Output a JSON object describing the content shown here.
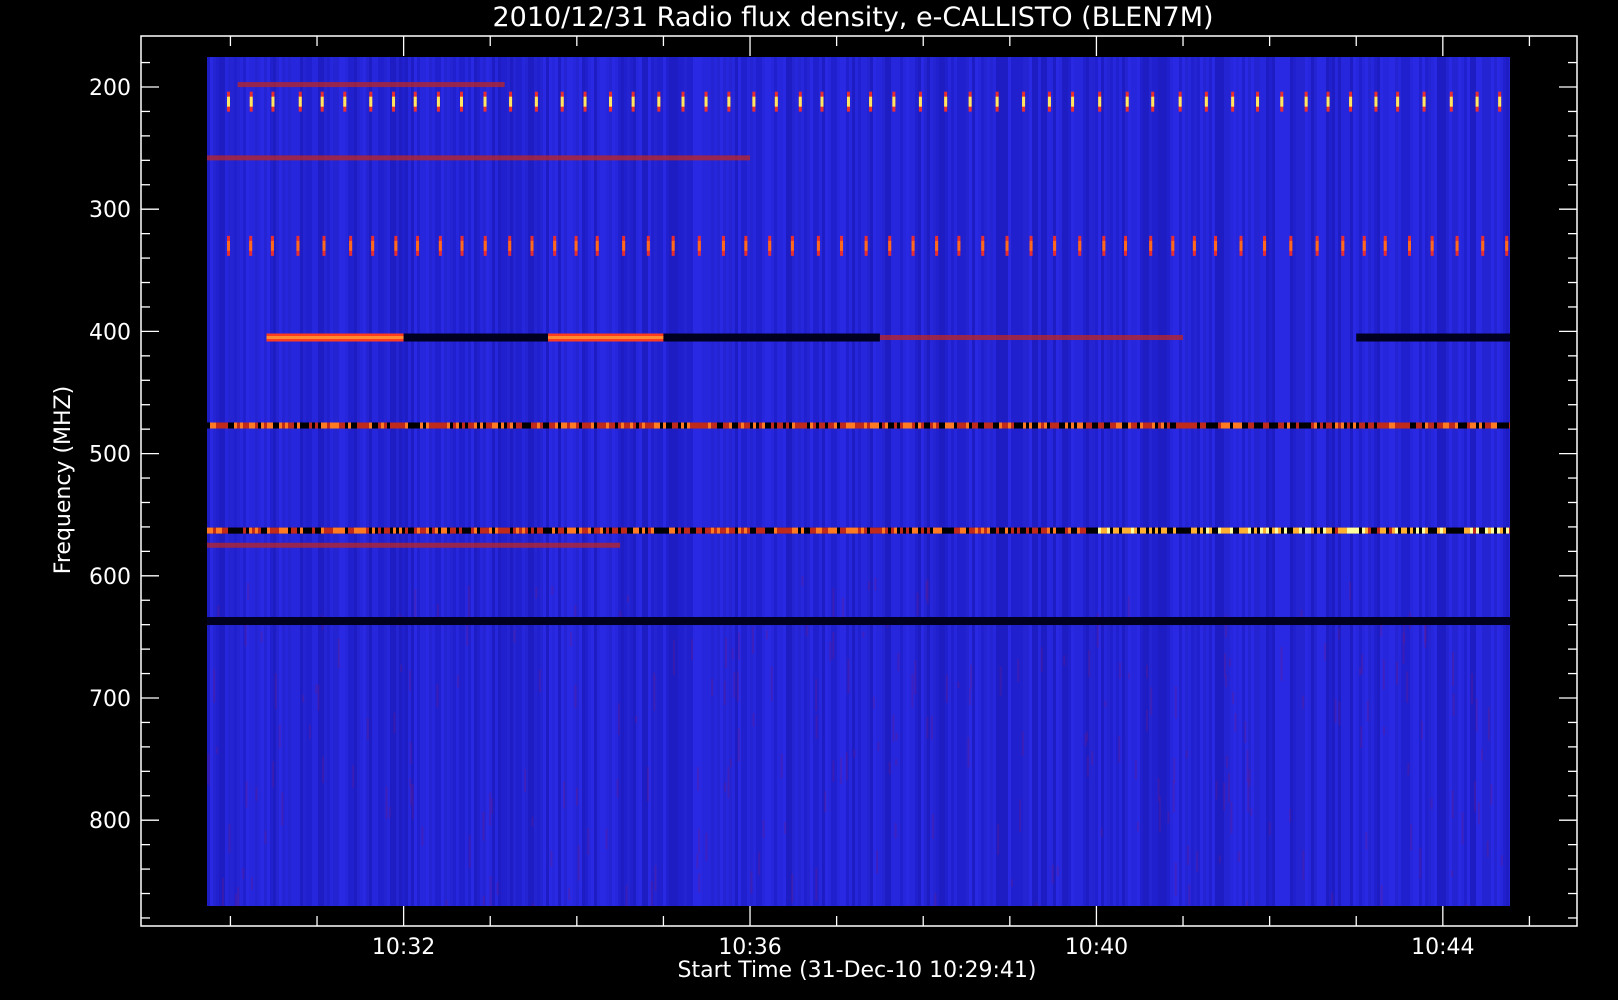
{
  "chart_data": {
    "type": "heatmap",
    "title": "2010/12/31  Radio flux density, e-CALLISTO (BLEN7M)",
    "xlabel": "Start Time (31-Dec-10 10:29:41)",
    "ylabel": "Frequency (MHZ)",
    "x_ticks": [
      "10:32",
      "10:36",
      "10:40",
      "10:44"
    ],
    "y_ticks": [
      "200",
      "300",
      "400",
      "500",
      "600",
      "700",
      "800"
    ],
    "x_range_minutes": [
      10.5,
      10.75
    ],
    "y_range_mhz": [
      177,
      875
    ],
    "y_axis_inverted": true,
    "colormap": "blue-red-yellow",
    "colors": {
      "background": "#000000",
      "axis": "#ffffff",
      "baseline": "#2323d6",
      "low": "#00005a",
      "high": "#ff3b1f",
      "peak": "#ffff9a"
    },
    "features": [
      {
        "kind": "band",
        "freq_mhz": 198,
        "level": "red",
        "time": [
          "10:30:05",
          "10:33:10"
        ]
      },
      {
        "kind": "periodic",
        "freq_mhz": 212,
        "level": "yellow",
        "time": [
          "10:29:41",
          "10:45:00"
        ]
      },
      {
        "kind": "band",
        "freq_mhz": 258,
        "level": "red",
        "time": [
          "10:29:41",
          "10:36:00"
        ]
      },
      {
        "kind": "periodic",
        "freq_mhz": 330,
        "level": "orange",
        "time": [
          "10:29:41",
          "10:45:00"
        ]
      },
      {
        "kind": "band",
        "freq_mhz": 405,
        "level": "bright-red",
        "time": [
          "10:30:25",
          "10:32:00"
        ]
      },
      {
        "kind": "band",
        "freq_mhz": 405,
        "level": "bright-red",
        "time": [
          "10:33:40",
          "10:35:00"
        ]
      },
      {
        "kind": "band",
        "freq_mhz": 405,
        "level": "dark",
        "time": [
          "10:32:00",
          "10:33:40"
        ]
      },
      {
        "kind": "band",
        "freq_mhz": 405,
        "level": "dark",
        "time": [
          "10:35:00",
          "10:37:30"
        ]
      },
      {
        "kind": "band",
        "freq_mhz": 405,
        "level": "red",
        "time": [
          "10:37:30",
          "10:41:00"
        ]
      },
      {
        "kind": "band",
        "freq_mhz": 405,
        "level": "dark",
        "time": [
          "10:43:00",
          "10:45:00"
        ]
      },
      {
        "kind": "band",
        "freq_mhz": 477,
        "level": "mixed",
        "time": [
          "10:29:41",
          "10:45:00"
        ]
      },
      {
        "kind": "band",
        "freq_mhz": 563,
        "level": "mixed-bright",
        "time": [
          "10:29:41",
          "10:45:00"
        ]
      },
      {
        "kind": "band",
        "freq_mhz": 575,
        "level": "red",
        "time": [
          "10:29:41",
          "10:34:30"
        ]
      },
      {
        "kind": "band",
        "freq_mhz": 637,
        "level": "dark",
        "time": [
          "10:29:41",
          "10:45:00"
        ]
      }
    ]
  }
}
